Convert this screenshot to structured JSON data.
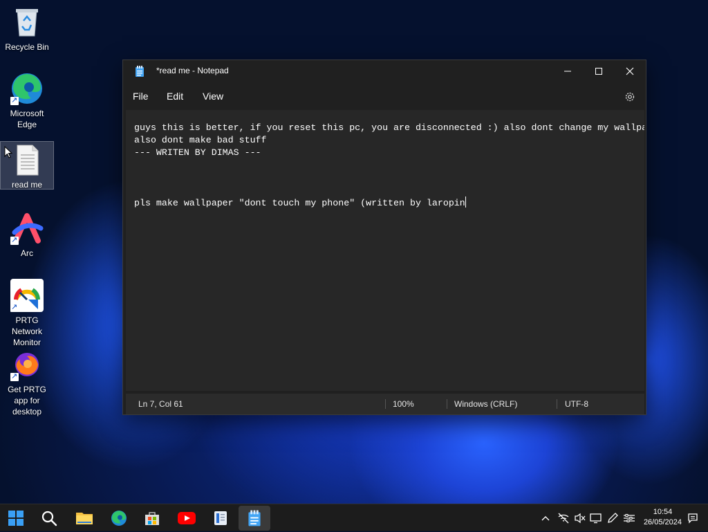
{
  "desktop": {
    "icons": [
      {
        "label": "Recycle Bin",
        "icon": "recycle-bin-icon"
      },
      {
        "label": "Microsoft Edge",
        "icon": "edge-icon"
      },
      {
        "label": "read me",
        "icon": "text-document-icon"
      },
      {
        "label": "Arc",
        "icon": "arc-browser-icon"
      },
      {
        "label": "PRTG Network Monitor",
        "icon": "prtg-gauge-icon"
      },
      {
        "label": "Get PRTG app for desktop",
        "icon": "firefox-icon"
      }
    ]
  },
  "notepad": {
    "title": "*read me - Notepad",
    "menu": {
      "file": "File",
      "edit": "Edit",
      "view": "View"
    },
    "content": {
      "line1": "guys this is better, if you reset this pc, you are disconnected :) also dont change my wallpa",
      "line2": "also dont make bad stuff",
      "line3": "--- WRITEN BY DIMAS ---",
      "line4": "",
      "line5": "",
      "line6": "",
      "line7": "pls make wallpaper \"dont touch my phone\" (written by laropin"
    },
    "status": {
      "position": "Ln 7, Col 61",
      "zoom": "100%",
      "line_ending": "Windows (CRLF)",
      "encoding": "UTF-8"
    }
  },
  "taskbar": {
    "apps": [
      "start-icon",
      "search-icon",
      "file-explorer-icon",
      "edge-icon",
      "microsoft-store-icon",
      "youtube-icon",
      "reader-icon",
      "notepad-icon"
    ],
    "tray": [
      "chevron-up-icon",
      "network-off-icon",
      "volume-muted-icon",
      "display-icon",
      "pen-icon",
      "sliders-icon"
    ],
    "time": "10:54",
    "date": "26/05/2024"
  }
}
